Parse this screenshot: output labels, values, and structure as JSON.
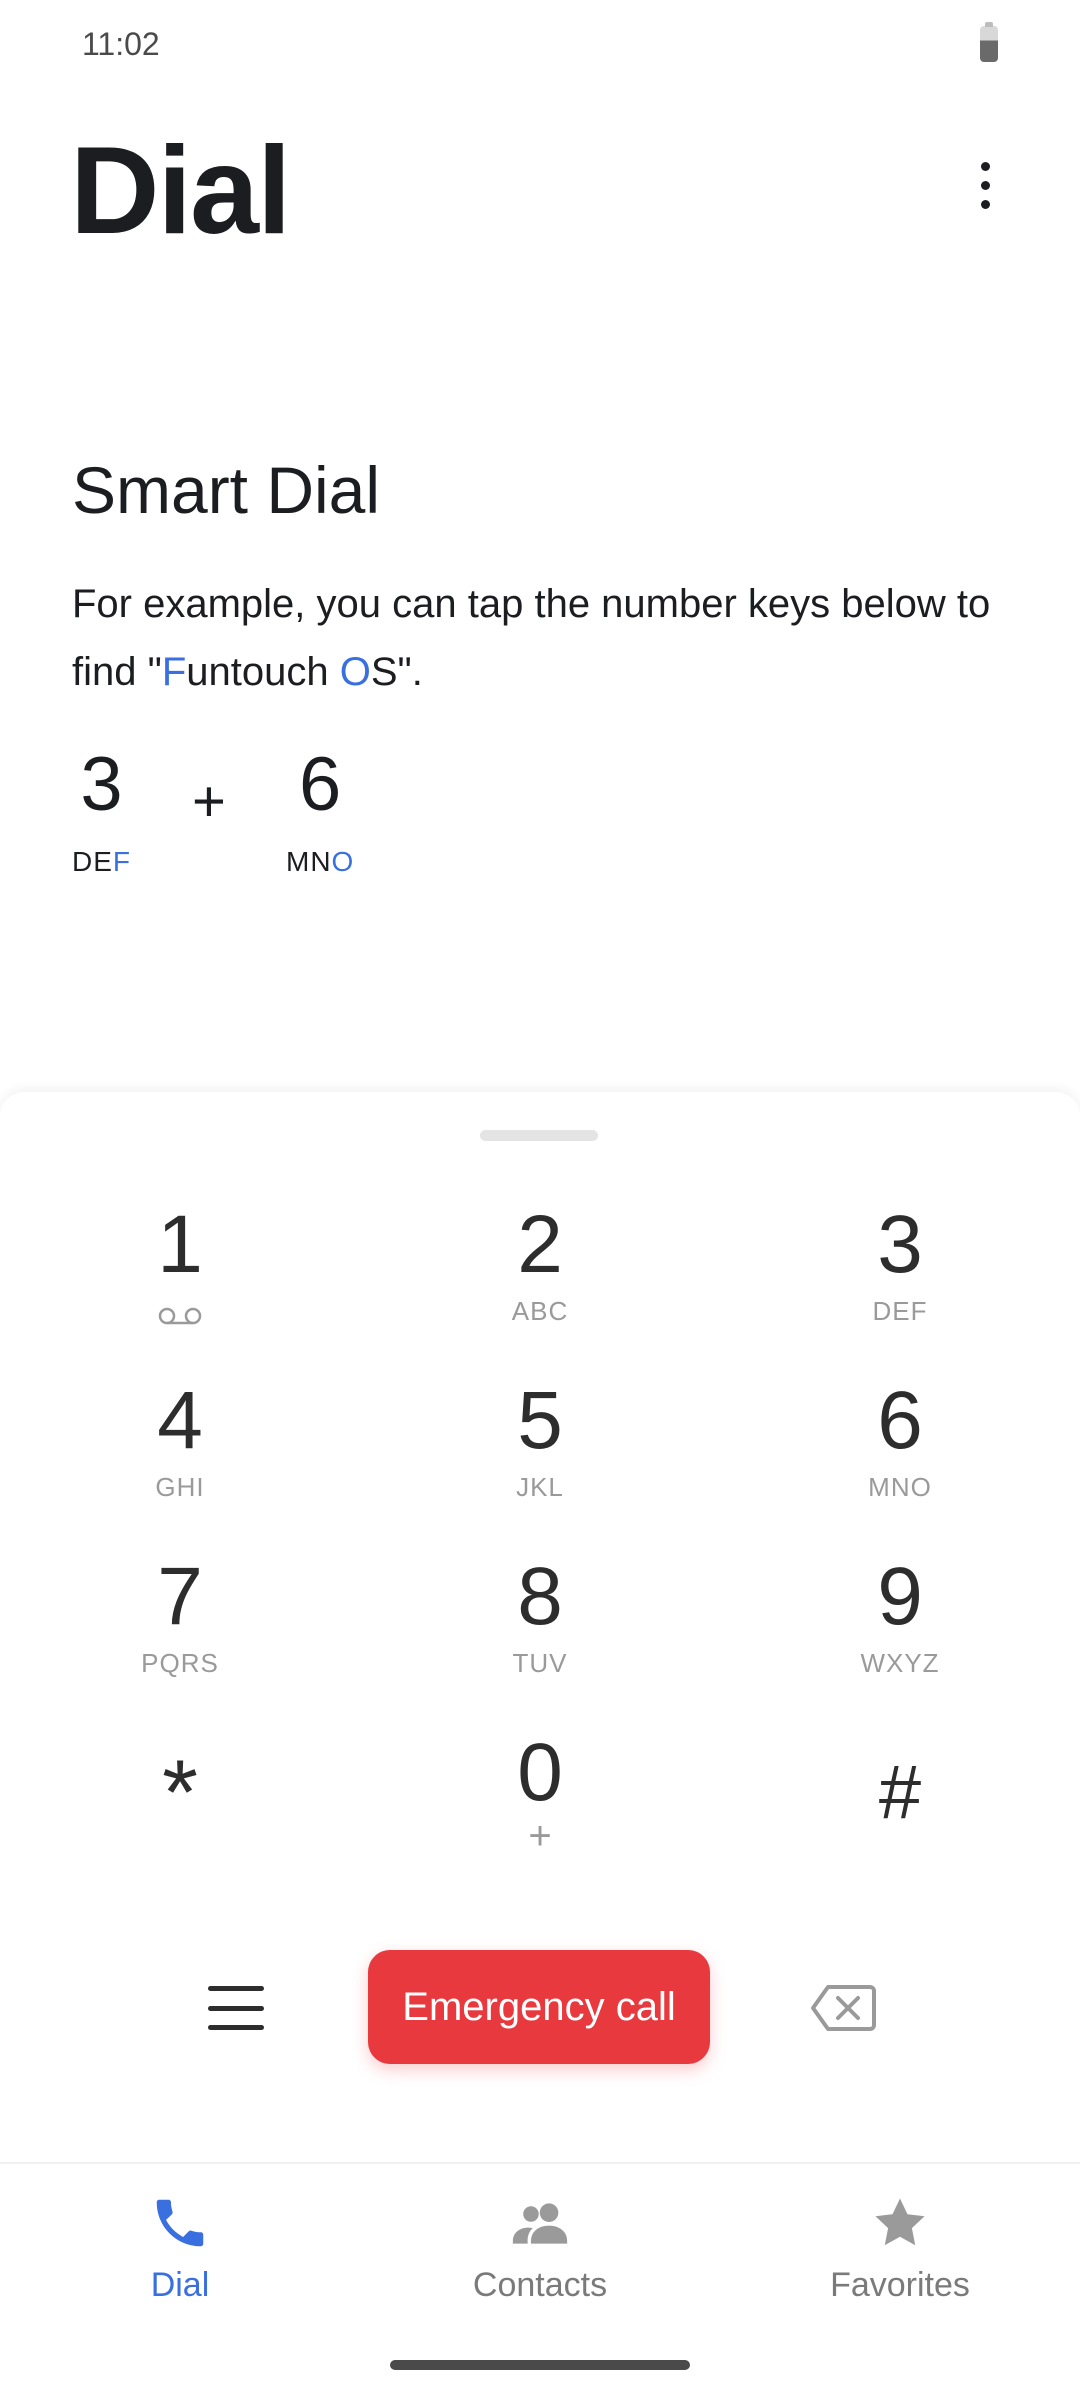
{
  "status_bar": {
    "time": "11:02"
  },
  "header": {
    "title": "Dial"
  },
  "smart_dial": {
    "title": "Smart Dial",
    "desc_before": "For example, you can tap the number keys below to find \"",
    "highlight_1": "F",
    "desc_middle": "untouch ",
    "highlight_2": "O",
    "desc_after": "S\".",
    "example_key_1": {
      "digit": "3",
      "letters": "DE",
      "highlight": "F"
    },
    "example_plus": "+",
    "example_key_2": {
      "digit": "6",
      "letters": "MN",
      "highlight": "O"
    }
  },
  "keypad": {
    "keys": [
      {
        "digit": "1",
        "letters": ""
      },
      {
        "digit": "2",
        "letters": "ABC"
      },
      {
        "digit": "3",
        "letters": "DEF"
      },
      {
        "digit": "4",
        "letters": "GHI"
      },
      {
        "digit": "5",
        "letters": "JKL"
      },
      {
        "digit": "6",
        "letters": "MNO"
      },
      {
        "digit": "7",
        "letters": "PQRS"
      },
      {
        "digit": "8",
        "letters": "TUV"
      },
      {
        "digit": "9",
        "letters": "WXYZ"
      },
      {
        "digit": "*",
        "letters": ""
      },
      {
        "digit": "0",
        "letters": "+"
      },
      {
        "digit": "#",
        "letters": ""
      }
    ]
  },
  "actions": {
    "menu_icon": "menu-icon",
    "emergency_label": "Emergency call",
    "backspace_icon": "backspace-icon"
  },
  "bottom_nav": {
    "items": [
      {
        "label": "Dial",
        "icon": "phone-icon",
        "active": true
      },
      {
        "label": "Contacts",
        "icon": "contacts-icon",
        "active": false
      },
      {
        "label": "Favorites",
        "icon": "star-icon",
        "active": false
      }
    ]
  },
  "colors": {
    "accent": "#3a6fe0",
    "emergency": "#e8393e"
  }
}
